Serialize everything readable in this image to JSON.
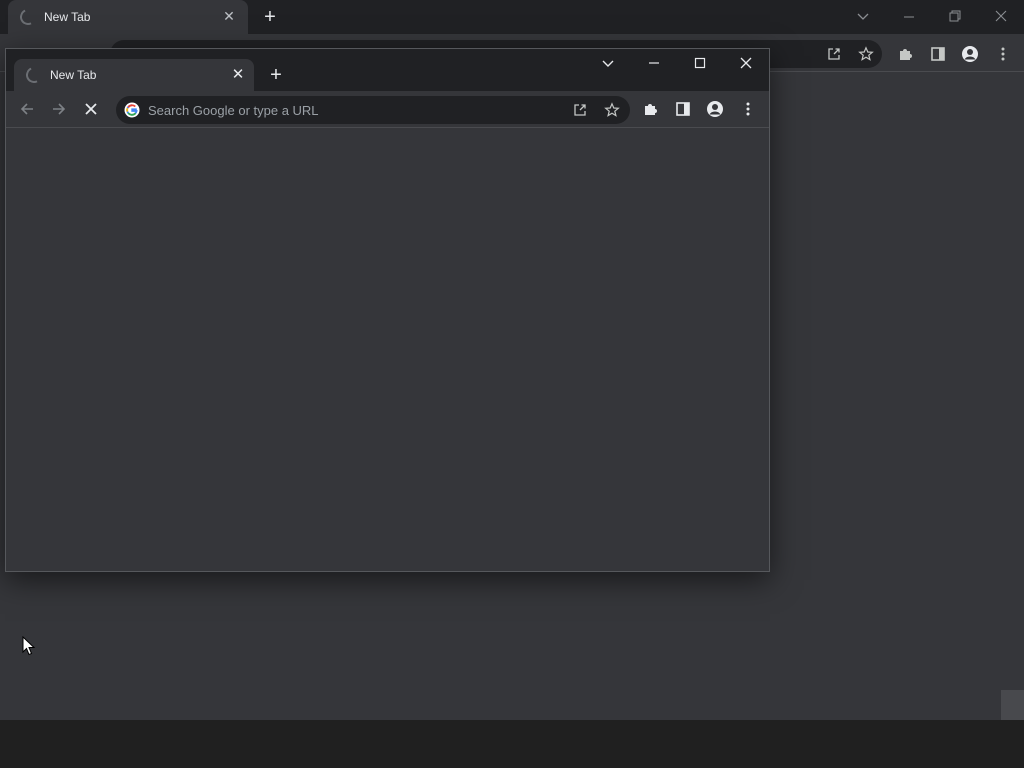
{
  "background_window": {
    "tab": {
      "title": "New Tab"
    },
    "new_tab_glyph": "+",
    "close_glyph": "✕",
    "controls": [
      "tab-search",
      "minimize",
      "restore",
      "close"
    ]
  },
  "foreground_window": {
    "tab": {
      "title": "New Tab"
    },
    "new_tab_glyph": "+",
    "close_glyph": "✕",
    "controls": [
      "tab-search",
      "minimize",
      "maximize",
      "close"
    ],
    "omnibox": {
      "placeholder": "Search Google or type a URL"
    }
  },
  "colors": {
    "frame": "#202124",
    "toolbar": "#35363a",
    "omnibox": "#202124",
    "text": "#e8eaed",
    "taskbar": "#202020"
  }
}
